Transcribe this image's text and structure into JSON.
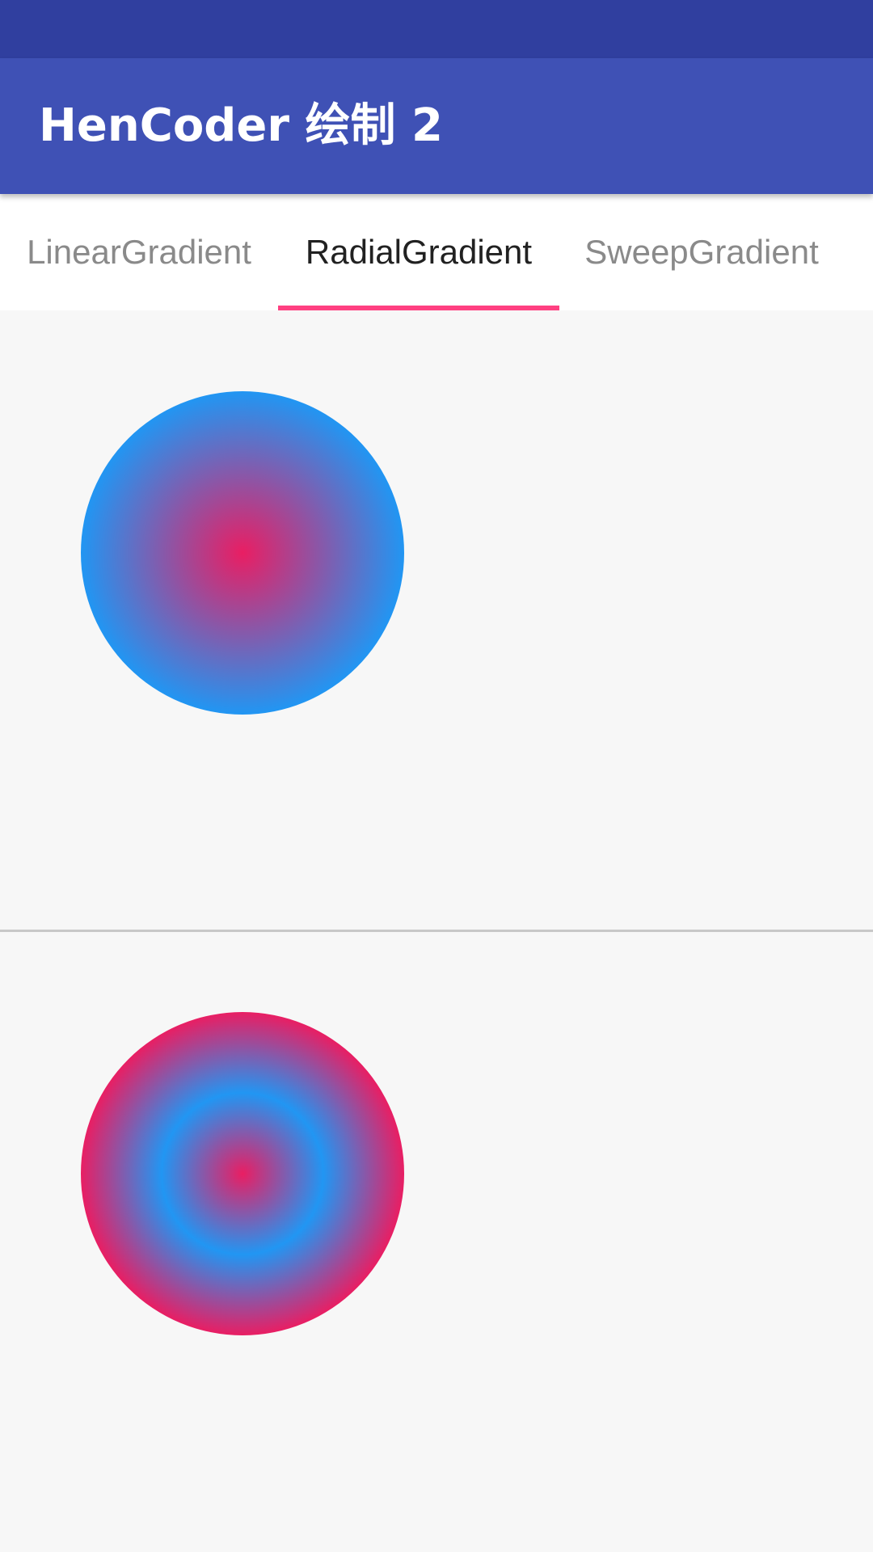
{
  "app_bar": {
    "title": "HenCoder 绘制 2",
    "color": "#3f51b5"
  },
  "status_bar": {
    "color": "#303f9f"
  },
  "tabs": [
    {
      "label": "LinearGradient",
      "selected": false
    },
    {
      "label": "RadialGradient",
      "selected": true
    },
    {
      "label": "SweepGradient",
      "selected": false
    }
  ],
  "tab_indicator_color": "#ff4081",
  "samples": [
    {
      "name": "radial-gradient-clamp",
      "center_color": "#e91e63",
      "edge_color": "#2196f3"
    },
    {
      "name": "radial-gradient-repeat",
      "center_color": "#e91e63",
      "edge_color": "#2196f3"
    }
  ]
}
